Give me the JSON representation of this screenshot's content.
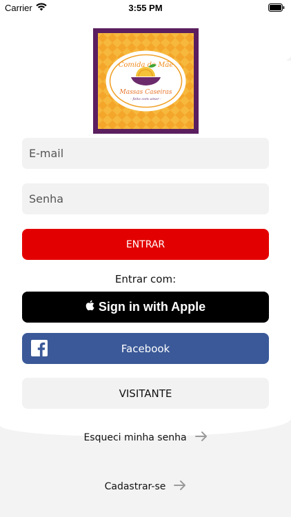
{
  "status_bar": {
    "carrier": "Carrier",
    "time": "3:55 PM"
  },
  "logo": {
    "line1": "Comida de Mãe",
    "line2": "Massas Caseiras",
    "line3": "- feito com amor -",
    "colors": {
      "frame": "#5a1e5c",
      "pattern": "#f2a32a",
      "accent": "#e34b2b"
    }
  },
  "form": {
    "email_placeholder": "E-mail",
    "password_placeholder": "Senha",
    "submit_label": "ENTRAR"
  },
  "social": {
    "heading": "Entrar com:",
    "apple_label": "Sign in with Apple",
    "facebook_label": "Facebook"
  },
  "guest_label": "VISITANTE",
  "links": {
    "forgot_password": "Esqueci minha senha",
    "register": "Cadastrar-se"
  },
  "colors": {
    "primary": "#e30000",
    "facebook": "#3b5998",
    "apple": "#000000",
    "field_bg": "#f2f2f2"
  }
}
